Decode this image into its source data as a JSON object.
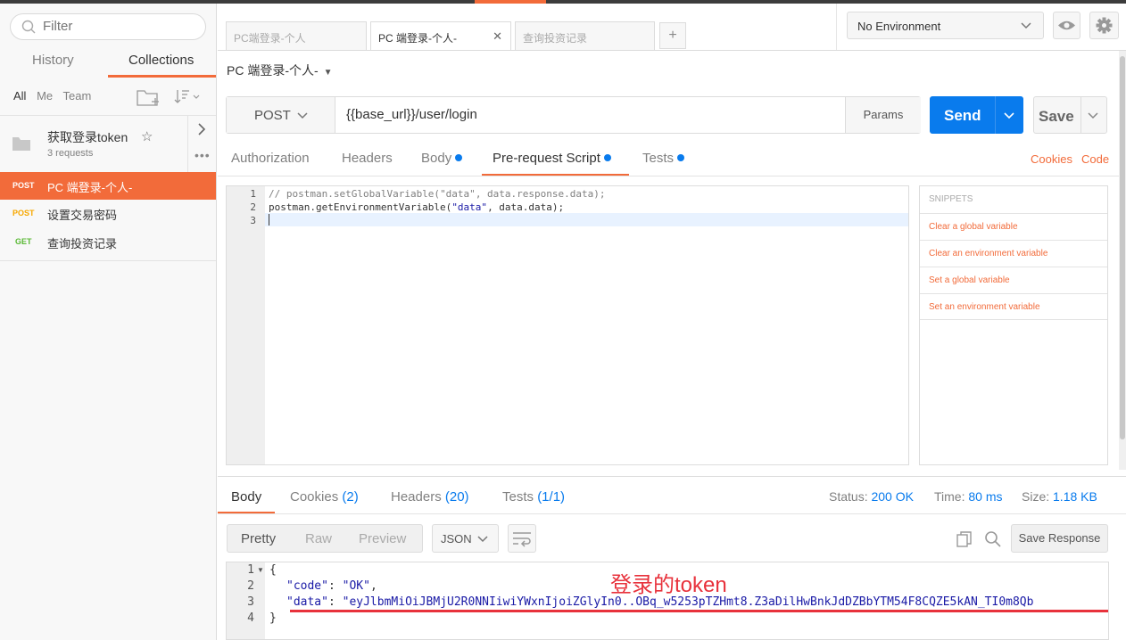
{
  "sidebar": {
    "filter_placeholder": "Filter",
    "tabs": [
      "History",
      "Collections"
    ],
    "filters": [
      "All",
      "Me",
      "Team"
    ],
    "collection": {
      "name": "获取登录token",
      "count": "3 requests"
    },
    "requests": [
      {
        "method": "POST",
        "name": "PC 端登录-个人-",
        "active": true
      },
      {
        "method": "POST",
        "name": "设置交易密码",
        "active": false
      },
      {
        "method": "GET",
        "name": "查询投资记录",
        "active": false
      }
    ]
  },
  "tabs": [
    {
      "label": "PC端登录-个人",
      "active": false
    },
    {
      "label": "PC 端登录-个人-",
      "active": true
    },
    {
      "label": "查询投资记录",
      "active": false
    }
  ],
  "environment": {
    "selected": "No Environment"
  },
  "request": {
    "name": "PC 端登录-个人-",
    "method": "POST",
    "url": "{{base_url}}/user/login",
    "params_label": "Params",
    "send_label": "Send",
    "save_label": "Save"
  },
  "request_tabs": [
    "Authorization",
    "Headers",
    "Body",
    "Pre-request Script",
    "Tests"
  ],
  "request_links": {
    "cookies": "Cookies",
    "code": "Code"
  },
  "script": {
    "line_numbers": [
      "1",
      "2",
      "3"
    ],
    "line1_a": "// postman.setGlobalVariable(",
    "line1_b": "\"data\"",
    "line1_c": ", data.response.data);",
    "line2_a": "postman.getEnvironmentVariable(",
    "line2_b": "\"data\"",
    "line2_c": ", data.data);"
  },
  "snippets": {
    "header": "SNIPPETS",
    "items": [
      "Clear a global variable",
      "Clear an environment variable",
      "Set a global variable",
      "Set an environment variable"
    ]
  },
  "response": {
    "tabs": {
      "body": "Body",
      "cookies": "Cookies",
      "cookies_count": "(2)",
      "headers": "Headers",
      "headers_count": "(20)",
      "tests": "Tests",
      "tests_count": "(1/1)"
    },
    "status_label": "Status:",
    "status": "200 OK",
    "time_label": "Time:",
    "time": "80 ms",
    "size_label": "Size:",
    "size": "1.18 KB",
    "formats": [
      "Pretty",
      "Raw",
      "Preview"
    ],
    "format_type": "JSON",
    "save_label": "Save Response",
    "line_numbers": [
      "1",
      "2",
      "3",
      "4"
    ],
    "l1": "{",
    "l2_key": "\"code\"",
    "l2_sep": ": ",
    "l2_val": "\"OK\"",
    "l2_end": ",",
    "l3_key": "\"data\"",
    "l3_sep": ": ",
    "l3_val": "\"eyJlbmMiOiJBMjU2R0NNIiwiYWxnIjoiZGlyIn0..OBq_w5253pTZHmt8.Z3aDilHwBnkJdDZBbYTM54F8CQZE5kAN_TI0m8Qb",
    "l4": "}"
  },
  "annotation": "登录的token",
  "colors": {
    "accent": "#f26b3a",
    "send": "#097bed",
    "post": "#f7a800",
    "get": "#5ab935",
    "annotation": "#e8323c"
  }
}
